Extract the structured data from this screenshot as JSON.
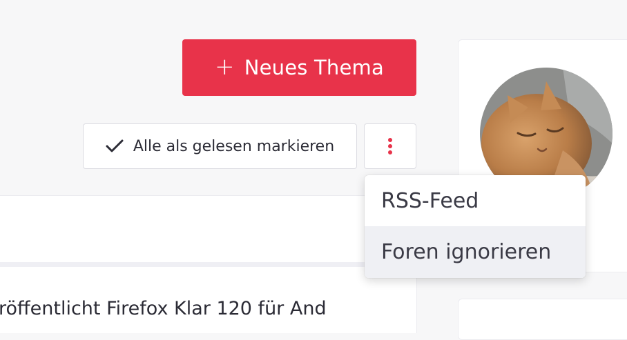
{
  "toolbar": {
    "new_topic_label": "Neues Thema",
    "mark_all_read_label": "Alle als gelesen markieren"
  },
  "menu": {
    "items": [
      {
        "label": "RSS-Feed"
      },
      {
        "label": "Foren ignorieren"
      }
    ]
  },
  "topic": {
    "title": "röffentlicht Firefox Klar 120 für And"
  },
  "colors": {
    "accent": "#e8334a",
    "background": "#f7f7f8",
    "hover": "#eff0f4"
  },
  "icons": {
    "new_topic": "plus-icon",
    "mark_read": "check-icon",
    "more": "vertical-dots-icon"
  }
}
